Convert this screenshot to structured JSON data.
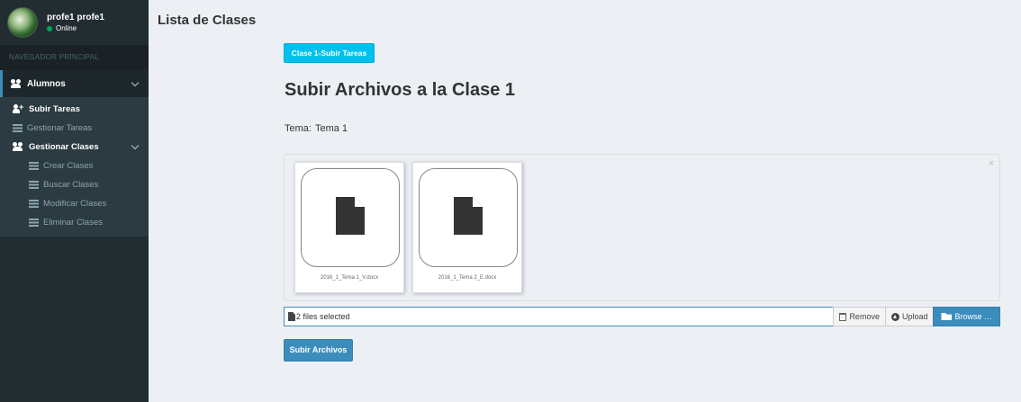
{
  "user": {
    "name": "profe1 profe1",
    "status": "Online"
  },
  "sidebar": {
    "header": "NAVEGADOR PRINCIPAL",
    "section": {
      "label": "Alumnos",
      "icon": "users-icon"
    },
    "items": [
      {
        "label": "Subir Tareas",
        "icon": "user-plus-icon"
      },
      {
        "label": "Gestionar Tareas",
        "icon": "list-icon"
      }
    ],
    "group": {
      "label": "Gestionar Clases",
      "icon": "users-icon",
      "items": [
        {
          "label": "Crear Clases",
          "icon": "list-icon"
        },
        {
          "label": "Buscar Clases",
          "icon": "list-icon"
        },
        {
          "label": "Modificar Clases",
          "icon": "list-icon"
        },
        {
          "label": "Eliminar Clases",
          "icon": "list-icon"
        }
      ]
    }
  },
  "main": {
    "page_title": "Lista de Clases",
    "tab_button": "Clase 1-Subir Tareas",
    "upload_title": "Subir Archivos a la Clase 1",
    "tema_label": "Tema:",
    "tema_value": "Tema 1",
    "files": [
      {
        "name": "2016_1_Tema 1_V.docx",
        "icon": "file-icon"
      },
      {
        "name": "2016_1_Tema 2_E.docx",
        "icon": "file-icon"
      }
    ],
    "file_caption": "2 files selected",
    "remove_label": "Remove",
    "upload_label": "Upload",
    "browse_label": "Browse …",
    "submit_label": "Subir Archivos"
  },
  "colors": {
    "sidebar_bg": "#222d32",
    "accent": "#3c8dbc",
    "info": "#00c0ef",
    "online": "#00a65a"
  }
}
